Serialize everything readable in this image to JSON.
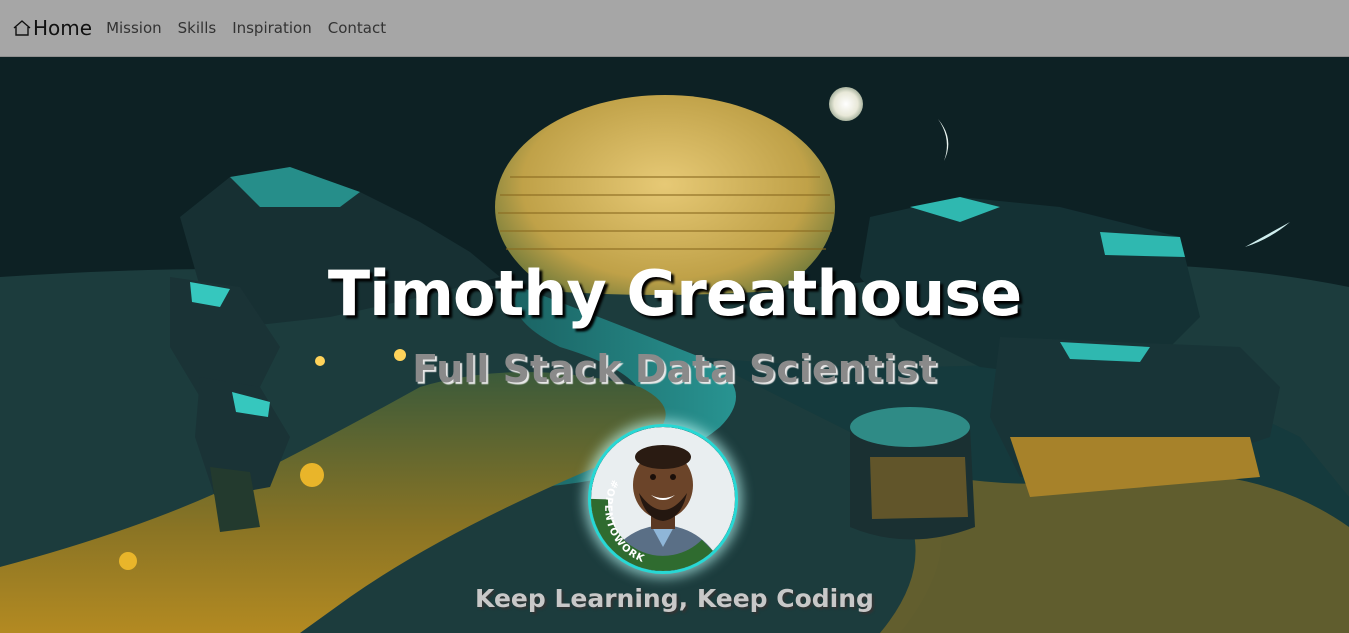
{
  "nav": {
    "brand_label": "Home",
    "links": [
      "Mission",
      "Skills",
      "Inspiration",
      "Contact"
    ]
  },
  "hero": {
    "name": "Timothy Greathouse",
    "role": "Full Stack Data Scientist",
    "motto": "Keep Learning, Keep Coding",
    "badge": "#OPENTOWORK"
  },
  "colors": {
    "navbar": "#a6a6a6",
    "accent_teal": "#27d8d4",
    "sand_gold": "#c9a23a",
    "badge_green": "#2f6b2f"
  }
}
